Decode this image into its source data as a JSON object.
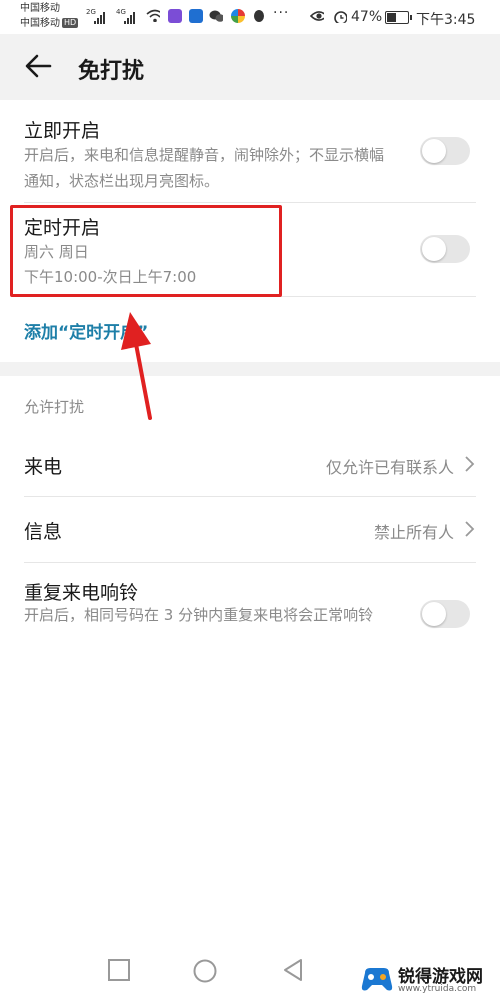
{
  "status_bar": {
    "carrier1": "中国移动",
    "carrier2": "中国移动",
    "hd": "HD",
    "net1": "2G",
    "net2": "4G",
    "more": "···",
    "battery": "47%",
    "time": "下午3:45",
    "icons": [
      "signal-icon",
      "wifi-icon",
      "video-app-icon",
      "shield-app-icon",
      "wechat-icon",
      "browser-icon",
      "qq-icon",
      "eye-icon",
      "alarm-icon",
      "battery-icon"
    ]
  },
  "header": {
    "title": "免打扰"
  },
  "immediate": {
    "title": "立即开启",
    "desc": "开启后，来电和信息提醒静音，闹钟除外；不显示横幅通知，状态栏出现月亮图标。",
    "enabled": false
  },
  "scheduled": {
    "title": "定时开启",
    "days": "周六 周日",
    "time": "下午10:00-次日上午7:00",
    "enabled": false
  },
  "add_link": "添加“定时开启”",
  "allow_section": {
    "label": "允许打扰",
    "calls_label": "来电",
    "calls_value": "仅允许已有联系人",
    "messages_label": "信息",
    "messages_value": "禁止所有人"
  },
  "repeat_calls": {
    "title": "重复来电响铃",
    "desc": "开启后，相同号码在 3 分钟内重复来电将会正常响铃",
    "enabled": false
  },
  "watermark": {
    "name": "锐得游戏网",
    "url": "www.ytruida.com"
  },
  "colors": {
    "accent": "#1e7fa8",
    "highlight": "#e02121",
    "header_bg": "#f2f2f2"
  }
}
